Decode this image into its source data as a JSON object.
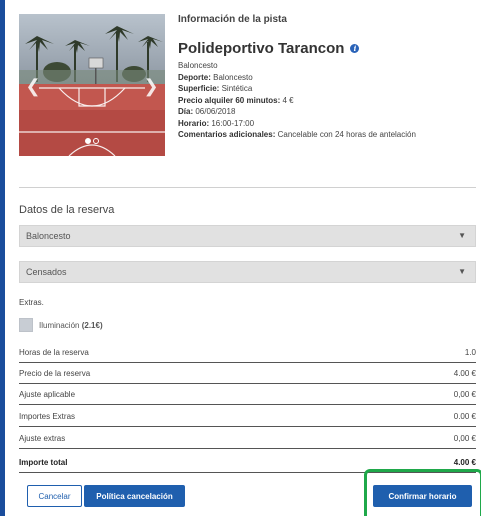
{
  "court_info": {
    "heading": "Información de la pista",
    "name": "Polideportivo Tarancon",
    "sport_plain": "Baloncesto",
    "details": [
      {
        "label": "Deporte:",
        "value": "Baloncesto"
      },
      {
        "label": "Superficie:",
        "value": "Sintética"
      },
      {
        "label": "Precio alquiler 60 minutos:",
        "value": "4 €"
      },
      {
        "label": "Día:",
        "value": "06/06/2018"
      },
      {
        "label": "Horario:",
        "value": "16:00-17:00"
      },
      {
        "label": "Comentarios adicionales:",
        "value": "Cancelable con 24 horas de antelación"
      }
    ]
  },
  "booking": {
    "title": "Datos de la reserva",
    "sport_select": "Baloncesto",
    "group_select": "Censados",
    "extras_label": "Extras.",
    "extra_item": "Iluminación",
    "extra_price": "(2.1€)"
  },
  "summary": [
    {
      "label": "Horas de la reserva",
      "value": "1.0"
    },
    {
      "label": "Precio de la reserva",
      "value": "4.00 €"
    },
    {
      "label": "Ajuste aplicable",
      "value": "0,00 €"
    },
    {
      "label": "Importes Extras",
      "value": "0.00 €"
    },
    {
      "label": "Ajuste extras",
      "value": "0,00 €"
    },
    {
      "label": "Importe total",
      "value": "4.00 €"
    }
  ],
  "buttons": {
    "cancel": "Cancelar",
    "policy": "Política cancelación",
    "confirm": "Confirmar horario"
  },
  "icons": {
    "info": "info-icon",
    "prev": "chevron-left-icon",
    "next": "chevron-right-icon",
    "dropdown": "caret-down-icon"
  },
  "colors": {
    "background": "#1a4d9c",
    "primary": "#1f5fae",
    "highlight": "#1fa84a"
  }
}
